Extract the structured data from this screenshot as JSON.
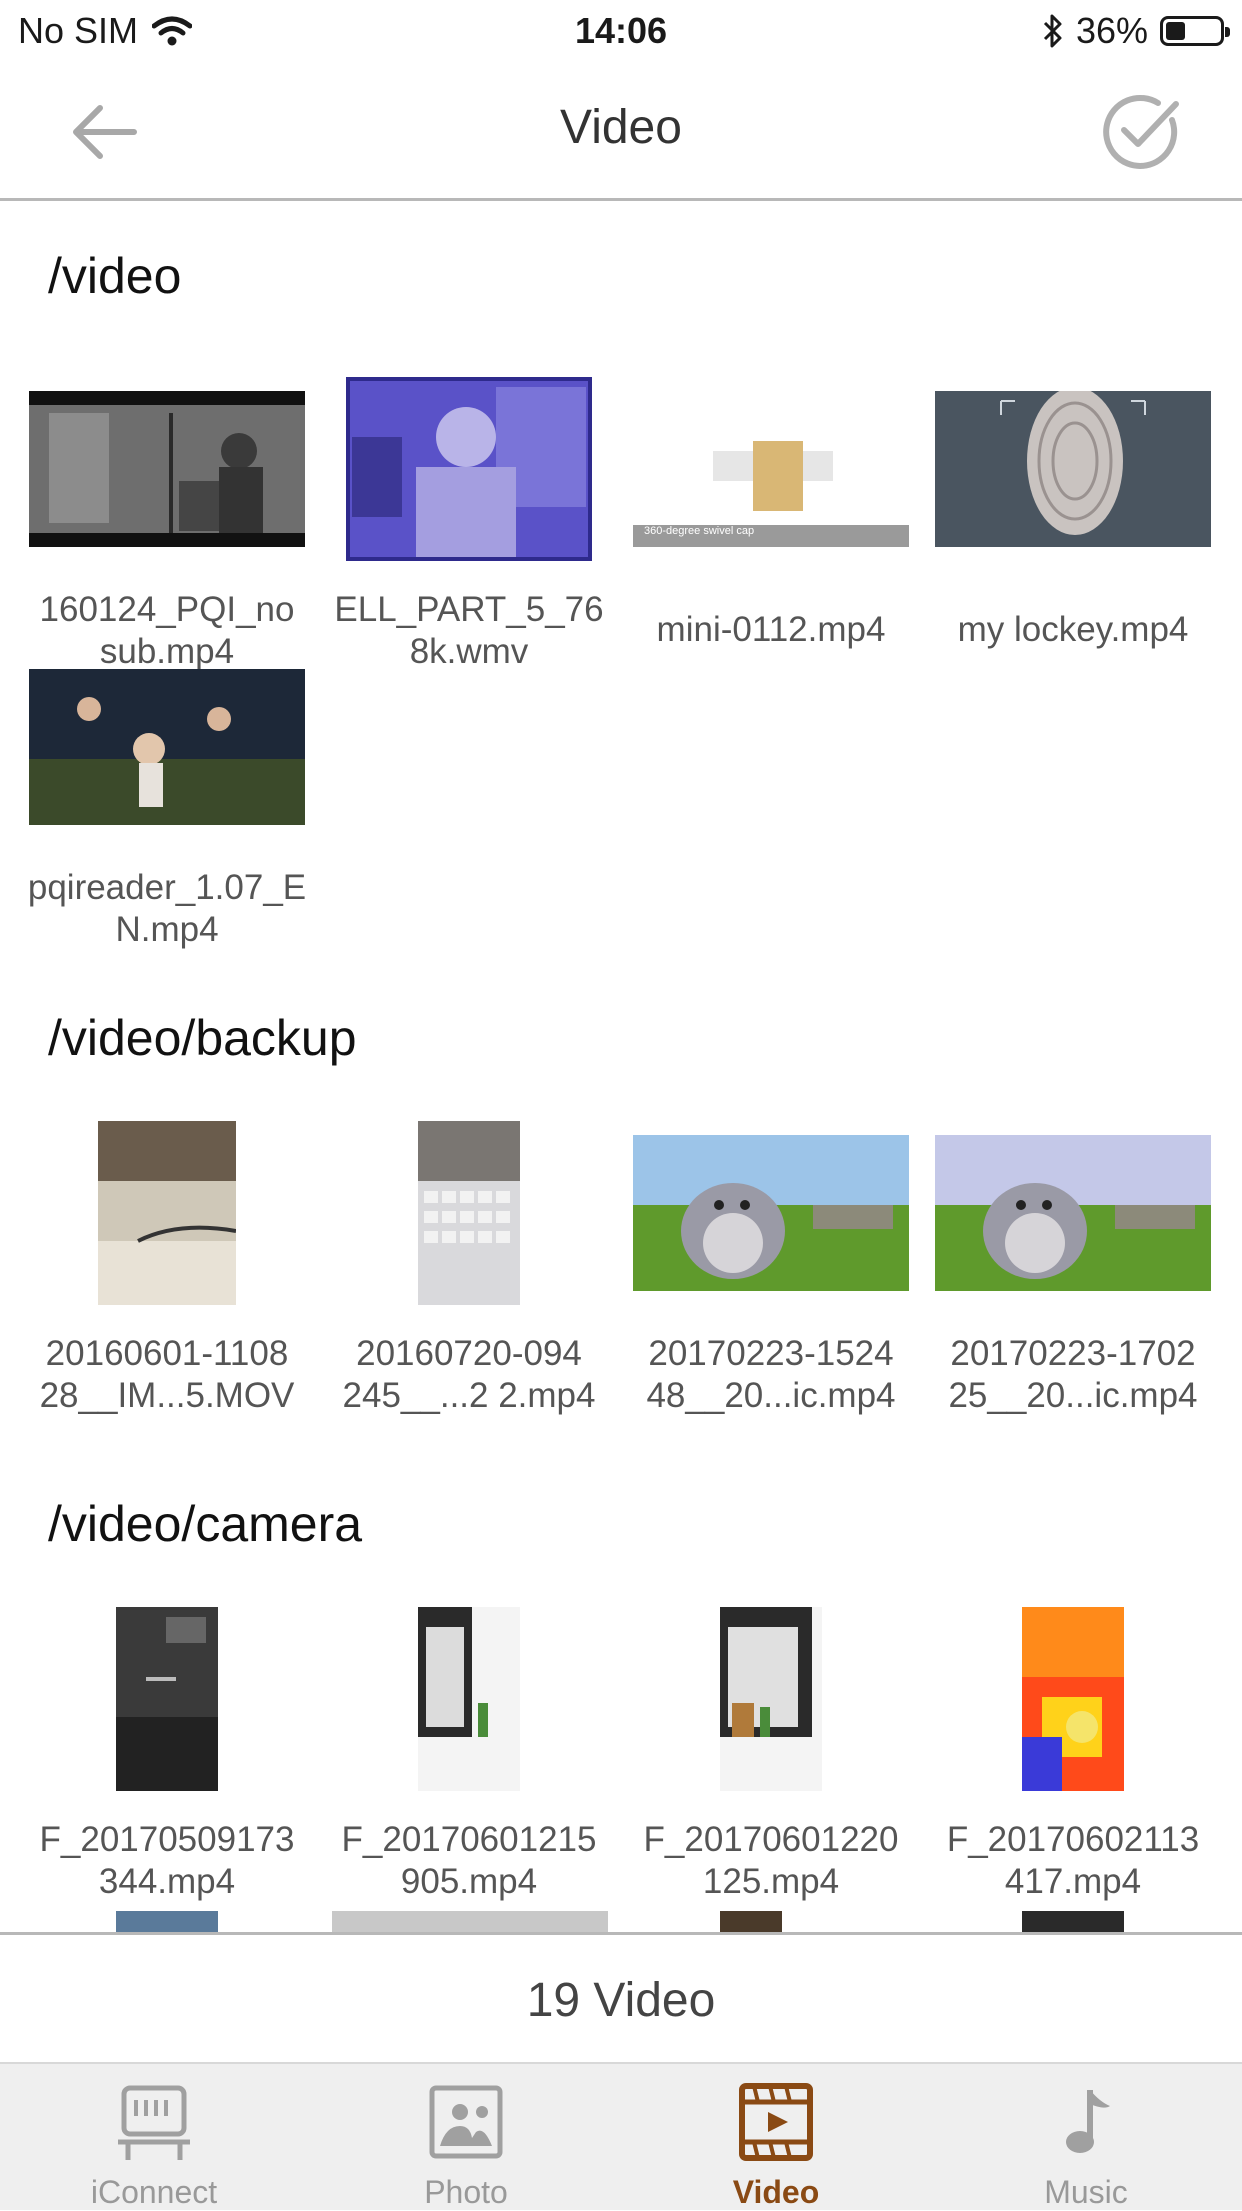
{
  "status_bar": {
    "carrier": "No SIM",
    "time": "14:06",
    "battery": "36%",
    "battery_level": 0.36
  },
  "nav": {
    "title": "Video"
  },
  "sections": [
    {
      "title": "/video",
      "items": [
        {
          "name": "160124_PQI_nosub.mp4",
          "line1": "160124_PQI_no",
          "line2": "sub.mp4"
        },
        {
          "name": "ELL_PART_5_768k.wmv",
          "line1": "ELL_PART_5_76",
          "line2": "8k.wmv"
        },
        {
          "name": "mini-0112.mp4",
          "line1": "mini-0112.mp4",
          "line2": "",
          "thumb_caption": "360-degree swivel cap"
        },
        {
          "name": "my lockey.mp4",
          "line1": "my lockey.mp4",
          "line2": ""
        },
        {
          "name": "pqireader_1.07_EN.mp4",
          "line1": "pqireader_1.07_E",
          "line2": "N.mp4"
        }
      ]
    },
    {
      "title": "/video/backup",
      "items": [
        {
          "line1": "20160601-1108",
          "line2": "28__IM...5.MOV"
        },
        {
          "line1": "20160720-094",
          "line2": "245__...2 2.mp4"
        },
        {
          "line1": "20170223-1524",
          "line2": "48__20...ic.mp4"
        },
        {
          "line1": "20170223-1702",
          "line2": "25__20...ic.mp4"
        }
      ]
    },
    {
      "title": "/video/camera",
      "items": [
        {
          "line1": "F_20170509173",
          "line2": "344.mp4"
        },
        {
          "line1": "F_20170601215",
          "line2": "905.mp4"
        },
        {
          "line1": "F_20170601220",
          "line2": "125.mp4"
        },
        {
          "line1": "F_20170602113",
          "line2": "417.mp4"
        }
      ]
    }
  ],
  "footer": {
    "count_label": "19 Video"
  },
  "tabs": [
    {
      "label": "iConnect",
      "icon": "iconnect-icon",
      "active": false
    },
    {
      "label": "Photo",
      "icon": "photo-icon",
      "active": false
    },
    {
      "label": "Video",
      "icon": "video-icon",
      "active": true
    },
    {
      "label": "Music",
      "icon": "music-note-icon",
      "active": false
    }
  ],
  "colors": {
    "accent": "#8a4a14",
    "inactive": "#999999",
    "divider": "#b8b8b8"
  }
}
